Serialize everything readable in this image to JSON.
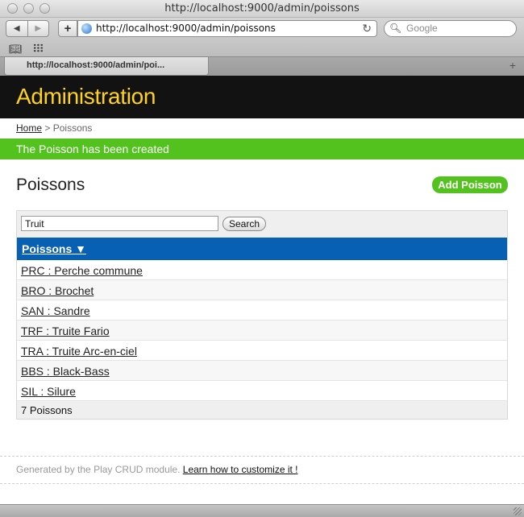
{
  "browser": {
    "window_title": "http://localhost:9000/admin/poissons",
    "url": "http://localhost:9000/admin/poissons",
    "search_placeholder": "Google",
    "tab_title": "http://localhost:9000/admin/poi..."
  },
  "page": {
    "app_title": "Administration",
    "breadcrumb": {
      "home": "Home",
      "separator": ">",
      "current": "Poissons"
    },
    "flash_message": "The Poisson has been created",
    "title": "Poissons",
    "add_button": "Add Poisson",
    "search": {
      "value": "Truit",
      "button": "Search"
    },
    "table": {
      "header": "Poissons ▼",
      "rows": [
        "PRC : Perche commune",
        "BRO : Brochet",
        "SAN : Sandre",
        "TRF : Truite Fario",
        "TRA : Truite Arc-en-ciel",
        "BBS : Black-Bass",
        "SIL : Silure"
      ],
      "count": "7 Poissons"
    },
    "footer": {
      "text": "Generated by the Play CRUD module.",
      "link": "Learn how to customize it !"
    }
  },
  "colors": {
    "header_bg": "#121212",
    "title_yellow": "#ffd21f",
    "success_green": "#53c21e",
    "table_head_blue": "#0860b5"
  },
  "icons": [
    "back-icon",
    "forward-icon",
    "add-bookmark-icon",
    "globe-icon",
    "reload-icon",
    "search-icon",
    "bookmarks-book-icon",
    "top-sites-grid-icon",
    "new-tab-icon",
    "resize-grip-icon"
  ]
}
